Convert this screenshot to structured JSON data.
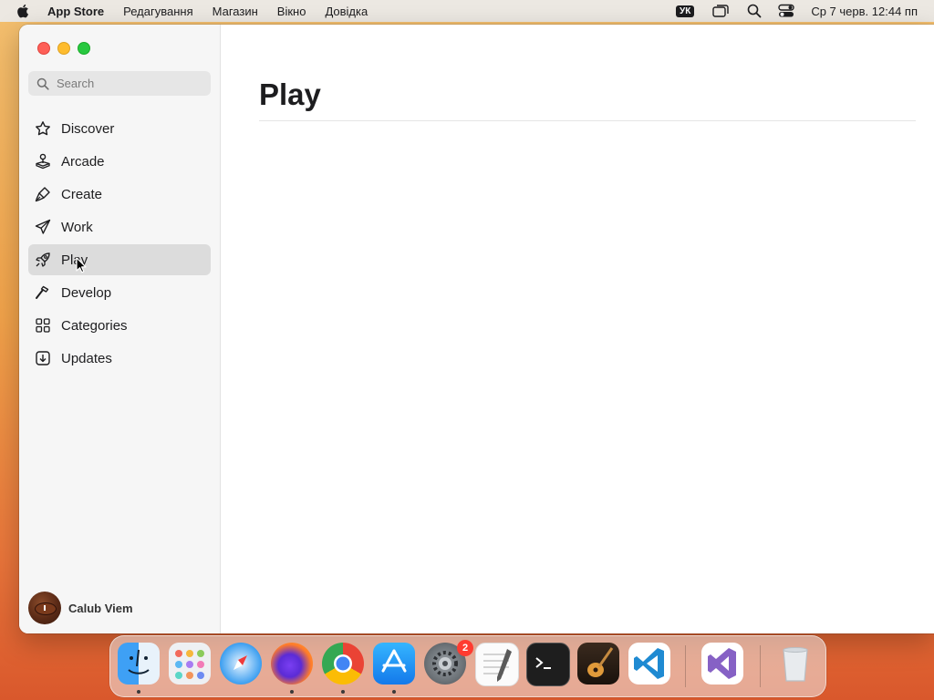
{
  "menubar": {
    "app_name": "App Store",
    "items": [
      "Редагування",
      "Магазин",
      "Вікно",
      "Довідка"
    ],
    "lang": "УК",
    "clock": "Ср 7 черв. 12:44 пп"
  },
  "search": {
    "placeholder": "Search",
    "value": ""
  },
  "sidebar": {
    "items": [
      {
        "label": "Discover",
        "icon": "star-icon"
      },
      {
        "label": "Arcade",
        "icon": "joystick-icon"
      },
      {
        "label": "Create",
        "icon": "brush-icon"
      },
      {
        "label": "Work",
        "icon": "paperplane-icon"
      },
      {
        "label": "Play",
        "icon": "rocket-icon",
        "selected": true
      },
      {
        "label": "Develop",
        "icon": "hammer-icon"
      },
      {
        "label": "Categories",
        "icon": "grid-icon"
      },
      {
        "label": "Updates",
        "icon": "download-icon"
      }
    ]
  },
  "user": {
    "name": "Calub Viem"
  },
  "main": {
    "title": "Play"
  },
  "dock": {
    "apps": [
      "Finder",
      "Launchpad",
      "Safari",
      "Firefox",
      "Chrome",
      "App Store",
      "System Settings",
      "TextEdit",
      "Terminal",
      "GarageBand",
      "Visual Studio Code",
      "Visual Studio",
      "Trash"
    ],
    "settings_badge": "2"
  },
  "colors": {
    "accent": "#007aff",
    "selected_row": "#dcdcdc",
    "badge": "#ff3b30"
  }
}
